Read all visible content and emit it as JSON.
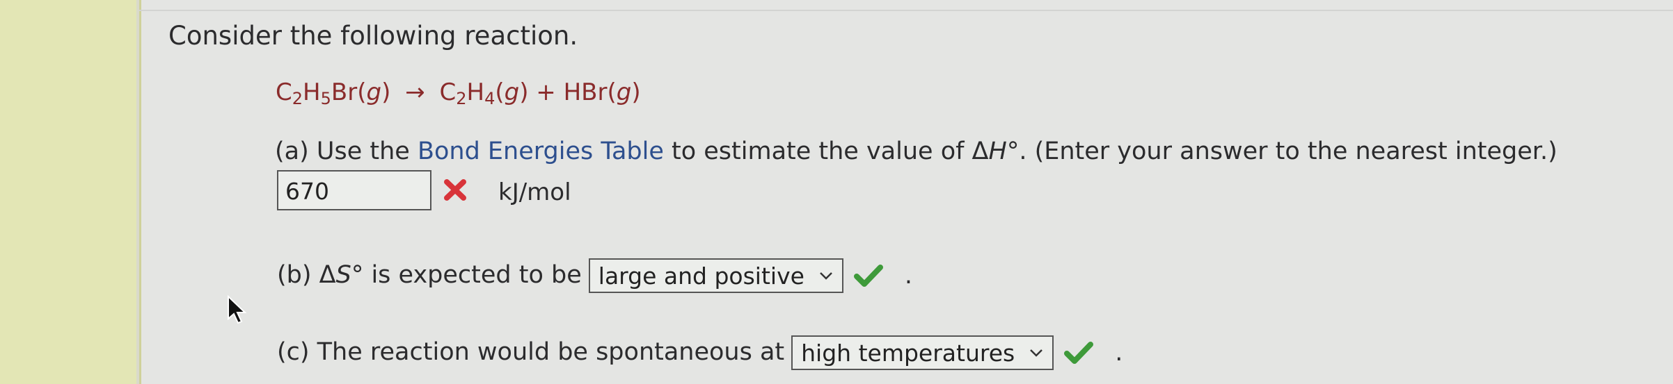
{
  "heading": "Consider the following reaction.",
  "equation": {
    "reactant": {
      "c": "C",
      "c_sub": "2",
      "h": "H",
      "h_sub": "5",
      "rest": "Br(",
      "phase": "g",
      "close": ")"
    },
    "arrow": "→",
    "product1": {
      "c": "C",
      "c_sub": "2",
      "h": "H",
      "h_sub": "4",
      "open": "(",
      "phase": "g",
      "close": ")"
    },
    "plus": "+",
    "product2": {
      "name": "HBr(",
      "phase": "g",
      "close": ")"
    }
  },
  "part_a": {
    "prefix": "(a) Use the ",
    "link_text": "Bond Energies Table",
    "middle": " to estimate the value of Δ",
    "symbol": "H",
    "suffix": "°. (Enter your answer to the nearest integer.)",
    "answer_value": "670",
    "status": "incorrect",
    "unit": "kJ/mol"
  },
  "part_b": {
    "prefix": "(b) Δ",
    "symbol": "S",
    "suffix": "° is expected to be",
    "selected": "large and positive",
    "status": "correct",
    "period": "."
  },
  "part_c": {
    "prefix": "(c) The reaction would be spontaneous at",
    "selected": "high temperatures",
    "status": "correct",
    "period": "."
  },
  "colors": {
    "equation": "#8a2b2b",
    "link": "#2d4f8e",
    "incorrect": "#d8343a",
    "correct": "#3e9a3a",
    "highlight_strip": "#e3e6b5"
  }
}
